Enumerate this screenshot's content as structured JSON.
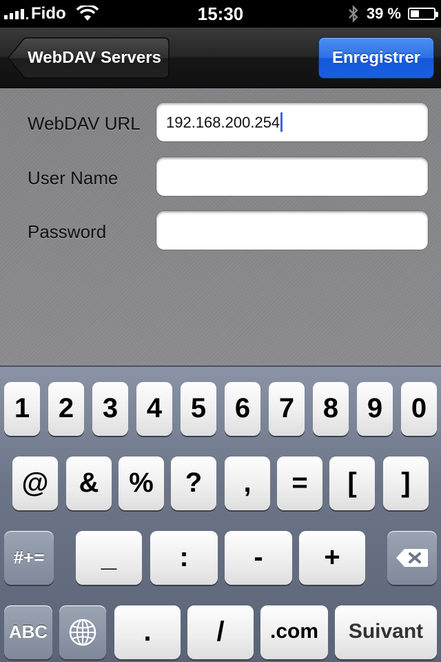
{
  "status_bar": {
    "carrier": "Fido",
    "time": "15:30",
    "battery_text": "39 %",
    "battery_level": 0.39,
    "signal_icon": "signal-bars-icon",
    "wifi_icon": "wifi-icon",
    "bluetooth_icon": "bluetooth-icon"
  },
  "nav": {
    "back_label": "WebDAV Servers",
    "save_label": "Enregistrer",
    "accent_color": "#2c6fe6"
  },
  "form": {
    "fields": [
      {
        "label": "WebDAV URL",
        "value": "192.168.200.254",
        "focused": true
      },
      {
        "label": "User Name",
        "value": ""
      },
      {
        "label": "Password",
        "value": ""
      }
    ]
  },
  "keyboard": {
    "row1": [
      "1",
      "2",
      "3",
      "4",
      "5",
      "6",
      "7",
      "8",
      "9",
      "0"
    ],
    "row2": [
      "@",
      "&",
      "%",
      "?",
      ",",
      "=",
      "[",
      "]"
    ],
    "row3": {
      "shift_label": "#+=",
      "keys": [
        "_",
        ":",
        "-",
        "+"
      ],
      "backspace_icon": "backspace-icon"
    },
    "row4": {
      "abc_label": "ABC",
      "globe_icon": "globe-icon",
      "keys": [
        ".",
        "/",
        ".com"
      ],
      "next_label": "Suivant"
    }
  }
}
